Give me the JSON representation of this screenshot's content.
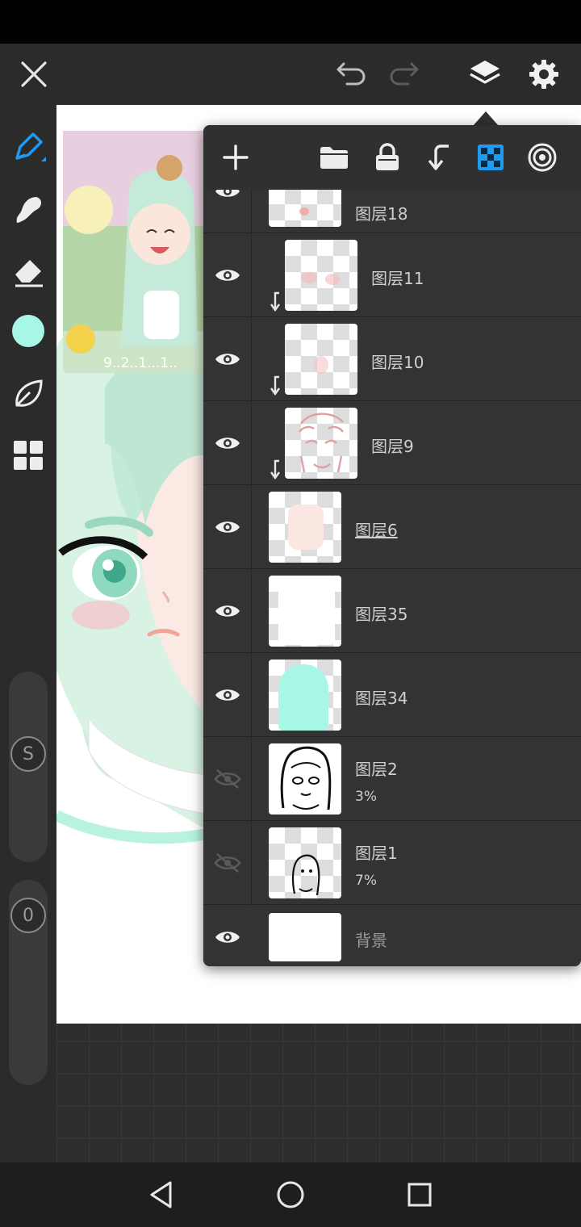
{
  "app": {
    "toolbar": {
      "close": "close-icon",
      "undo": "undo-icon",
      "redo": "redo-icon",
      "layers": "layers-icon",
      "settings": "gear-icon"
    },
    "tools": [
      "pen-icon",
      "smudge-icon",
      "eraser-icon",
      "color-swatch",
      "leaf-icon",
      "grid-icon"
    ],
    "current_color": "#a8f7e6",
    "brush_size_label": "S",
    "opacity_label": "0"
  },
  "layers_panel": {
    "toolbar_icons": [
      "add-layer-icon",
      "folder-icon",
      "lock-icon",
      "clip-icon",
      "alpha-lock-icon",
      "blend-icon"
    ],
    "layers": [
      {
        "name": "图层18",
        "visible": true,
        "clipped": false,
        "opacity": ""
      },
      {
        "name": "图层11",
        "visible": true,
        "clipped": true,
        "opacity": ""
      },
      {
        "name": "图层10",
        "visible": true,
        "clipped": true,
        "opacity": ""
      },
      {
        "name": "图层9",
        "visible": true,
        "clipped": true,
        "opacity": ""
      },
      {
        "name": "图层6",
        "visible": true,
        "clipped": false,
        "opacity": "",
        "selected": true
      },
      {
        "name": "图层35",
        "visible": true,
        "clipped": false,
        "opacity": ""
      },
      {
        "name": "图层34",
        "visible": true,
        "clipped": false,
        "opacity": ""
      },
      {
        "name": "图层2",
        "visible": false,
        "clipped": false,
        "opacity": "3%"
      },
      {
        "name": "图层1",
        "visible": false,
        "clipped": false,
        "opacity": "7%"
      },
      {
        "name": "背景",
        "visible": true,
        "clipped": false,
        "opacity": ""
      }
    ]
  },
  "reference_image": {
    "caption": "9..2..1...1.."
  },
  "colors": {
    "accent": "#1e9bf0",
    "panel_bg": "#303030",
    "toolbar_bg": "#2b2b2b"
  },
  "navbar": [
    "back-icon",
    "home-icon",
    "recents-icon"
  ]
}
